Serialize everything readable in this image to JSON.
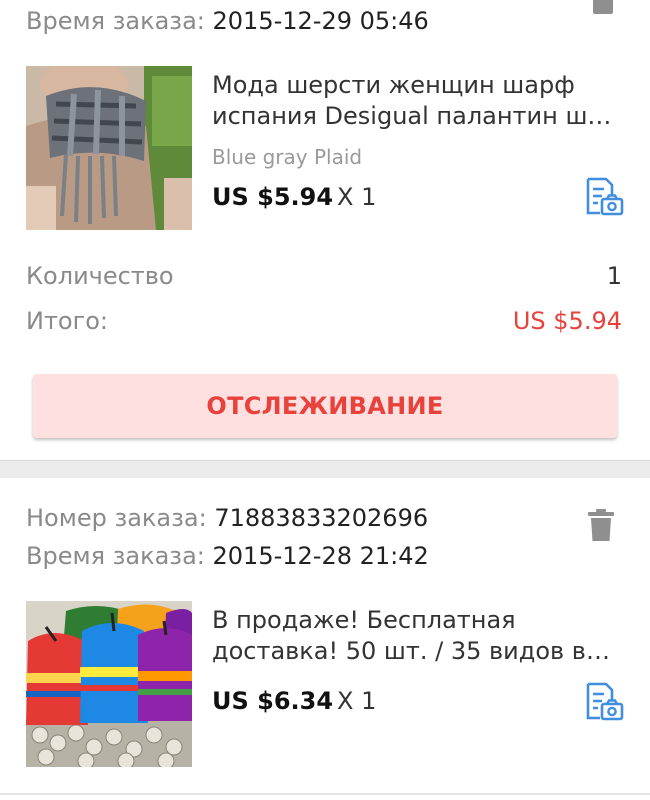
{
  "orders": [
    {
      "order_time_label": "Время заказа:",
      "order_time_value": "2015-12-29 05:46",
      "product": {
        "title_line1": "Мода шерсти женщин шарф",
        "title_line2": "испания Desigual палантин ша…",
        "variant": "Blue gray Plaid",
        "price": "US $5.94",
        "quantity": "X 1",
        "thumbnail_icon": "scarf-product-photo",
        "snapshot_icon": "order-snapshot-icon"
      },
      "summary": {
        "quantity_label": "Количество",
        "quantity_value": "1",
        "total_label": "Итого:",
        "total_value": "US $5.94"
      },
      "track_button_label": "ОТСЛЕЖИВАНИЕ"
    },
    {
      "order_number_label": "Номер заказа:",
      "order_number_value": "71883833202696",
      "order_time_label": "Время заказа:",
      "order_time_value": "2015-12-28 21:42",
      "delete_icon": "trash-icon",
      "product": {
        "title_line1": "В продаже! Бесплатная",
        "title_line2": "доставка! 50 шт. / 35 видов вк…",
        "price": "US $6.34",
        "quantity": "X 1",
        "thumbnail_icon": "gift-bags-product-photo",
        "snapshot_icon": "order-snapshot-icon"
      }
    }
  ],
  "colors": {
    "accent_red": "#e8423d",
    "button_bg": "#fde0df",
    "label_gray": "#8a8a8a",
    "icon_blue": "#3f8ee0"
  }
}
